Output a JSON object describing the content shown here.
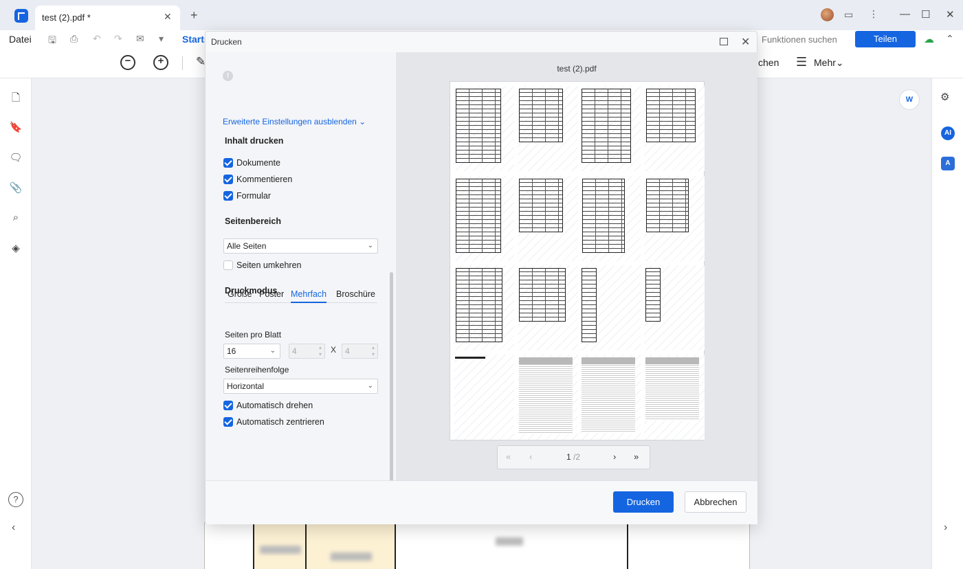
{
  "titlebar": {
    "tab_title": "test (2).pdf *",
    "tab_close": "✕",
    "new_tab": "+",
    "win_min": "—",
    "win_max": "☐",
    "win_close": "✕"
  },
  "toolbar": {
    "file_menu": "Datei",
    "start_tab": "Starts",
    "search_placeholder": "Funktionen suchen",
    "share_label": "Teilen",
    "partial_label": "chen",
    "more_label": "Mehr"
  },
  "dialog": {
    "title": "Drucken",
    "advanced_toggle": "Erweiterte Einstellungen ausblenden",
    "print_content": {
      "heading": "Inhalt drucken",
      "options": [
        {
          "label": "Dokumente",
          "checked": true
        },
        {
          "label": "Kommentieren",
          "checked": true
        },
        {
          "label": "Formular",
          "checked": true
        }
      ]
    },
    "page_range": {
      "heading": "Seitenbereich",
      "selected": "Alle Seiten",
      "reverse_label": "Seiten umkehren",
      "reverse_checked": false
    },
    "print_mode": {
      "heading": "Druckmodus",
      "tabs": [
        "Größe",
        "Poster",
        "Mehrfach",
        "Broschüre"
      ],
      "active_tab": "Mehrfach",
      "pages_per_sheet_label": "Seiten pro Blatt",
      "pages_per_sheet": "16",
      "cols": "4",
      "rows": "4",
      "times": "X",
      "order_label": "Seitenreihenfolge",
      "order": "Horizontal",
      "auto_rotate": "Automatisch drehen",
      "auto_rotate_checked": true,
      "auto_center": "Automatisch zentrieren",
      "auto_center_checked": true
    },
    "preview": {
      "filename": "test (2).pdf",
      "current_page": "1",
      "total_pages": "/2"
    },
    "print_button": "Drucken",
    "cancel_button": "Abbrechen"
  },
  "icons": {
    "sidebar_left": [
      "page-icon",
      "bookmark-icon",
      "comment-icon",
      "attachment-icon",
      "search-icon",
      "layers-icon"
    ],
    "sidebar_right": [
      "sliders-icon",
      "ai-icon",
      "translate-icon"
    ]
  },
  "colors": {
    "accent": "#1565e0",
    "sync_ok": "#2aa34a"
  }
}
